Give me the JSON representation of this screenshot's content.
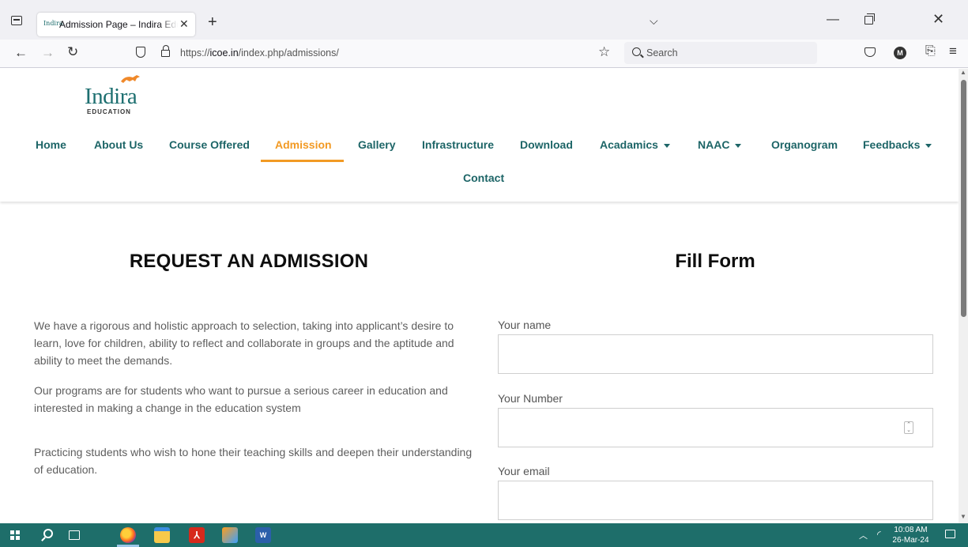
{
  "browser": {
    "tab_title": "Admission Page – Indira Educat",
    "tab_favicon_text": "Indira",
    "url_prefix": "https://",
    "url_domain": "icoe.in",
    "url_path": "/index.php/admissions/",
    "search_placeholder": "Search",
    "account_initial": "M"
  },
  "site": {
    "logo_word": "Indira",
    "logo_sub": "EDUCATION",
    "nav": [
      {
        "label": "Home"
      },
      {
        "label": "About Us"
      },
      {
        "label": "Course Offered"
      },
      {
        "label": "Admission",
        "active": true
      },
      {
        "label": "Gallery"
      },
      {
        "label": "Infrastructure"
      },
      {
        "label": "Download"
      },
      {
        "label": "Acadamics",
        "dropdown": true
      },
      {
        "label": "NAAC",
        "dropdown": true
      },
      {
        "label": "Organogram"
      },
      {
        "label": "Feedbacks",
        "dropdown": true
      },
      {
        "label": "Contact"
      }
    ],
    "accent_color": "#f29a24",
    "nav_color": "#1d6567"
  },
  "main": {
    "left_heading": "REQUEST AN ADMISSION",
    "right_heading": "Fill Form",
    "paragraphs": [
      "We have a rigorous and holistic approach to selection, taking into applicant’s desire to learn, love for children, ability to reflect and collaborate in groups and the aptitude and ability to meet the demands.",
      "Our programs are for students who want to pursue a serious career in education and interested in making a change in the education system",
      "Practicing students who wish to hone their teaching skills and deepen their understanding of education."
    ],
    "form": {
      "name_label": "Your name",
      "name_value": "",
      "number_label": "Your Number",
      "number_value": "",
      "email_label": "Your email",
      "email_value": ""
    }
  },
  "taskbar": {
    "time": "10:08 AM",
    "date": "26-Mar-24",
    "pdf_glyph": "⅄",
    "word_glyph": "W"
  }
}
